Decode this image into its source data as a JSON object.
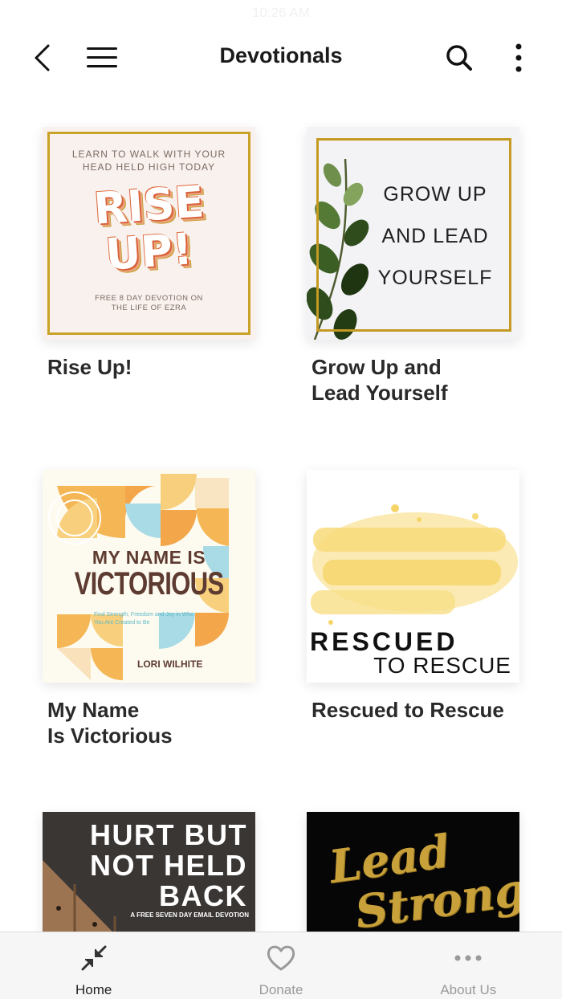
{
  "status_bar": {
    "time": "10:26 AM"
  },
  "header": {
    "title": "Devotionals",
    "icons": [
      "chevron-left-icon",
      "hamburger-menu-icon",
      "search-icon",
      "vertical-ellipsis-icon"
    ]
  },
  "devotionals": [
    {
      "caption_line1": "Rise Up!",
      "caption_line2": "",
      "cover": {
        "top_text_1": "LEARN TO WALK WITH YOUR",
        "top_text_2": "HEAD HELD HIGH TODAY",
        "big_1": "RISE",
        "big_2": "UP!",
        "bottom_1": "FREE 8 DAY DEVOTION ON",
        "bottom_2": "THE LIFE OF EZRA"
      }
    },
    {
      "caption_line1": "Grow Up and",
      "caption_line2": "Lead Yourself",
      "cover": {
        "line_1": "GROW UP",
        "line_2": "AND LEAD",
        "line_3": "YOURSELF"
      }
    },
    {
      "caption_line1": "My Name",
      "caption_line2": "Is Victorious",
      "cover": {
        "line_1": "MY NAME IS",
        "line_2": "VICTORIOUS",
        "tagline": "Find Strength, Freedom and Joy in Who You Are Created to Be",
        "author": "LORI WILHITE"
      }
    },
    {
      "caption_line1": "Rescued to Rescue",
      "caption_line2": "",
      "cover": {
        "line_1": "RESCUED",
        "line_2": "TO RESCUE"
      }
    },
    {
      "caption_line1": "",
      "caption_line2": "",
      "cover": {
        "line_1": "HURT BUT",
        "line_2": "NOT HELD",
        "line_3": "BACK",
        "subtitle": "A FREE SEVEN DAY EMAIL DEVOTION"
      }
    },
    {
      "caption_line1": "",
      "caption_line2": "",
      "cover": {
        "line_1": "Lead",
        "line_2": "Strong"
      }
    }
  ],
  "tabbar": {
    "tabs": [
      {
        "label": "Home",
        "icon": "compress-arrows-icon",
        "active": true
      },
      {
        "label": "Donate",
        "icon": "heart-icon",
        "active": false
      },
      {
        "label": "About Us",
        "icon": "horizontal-ellipsis-icon",
        "active": false
      }
    ]
  },
  "colors": {
    "gold": "#c9a227",
    "active_tab": "#222222",
    "inactive_tab": "#9a9a9a"
  }
}
